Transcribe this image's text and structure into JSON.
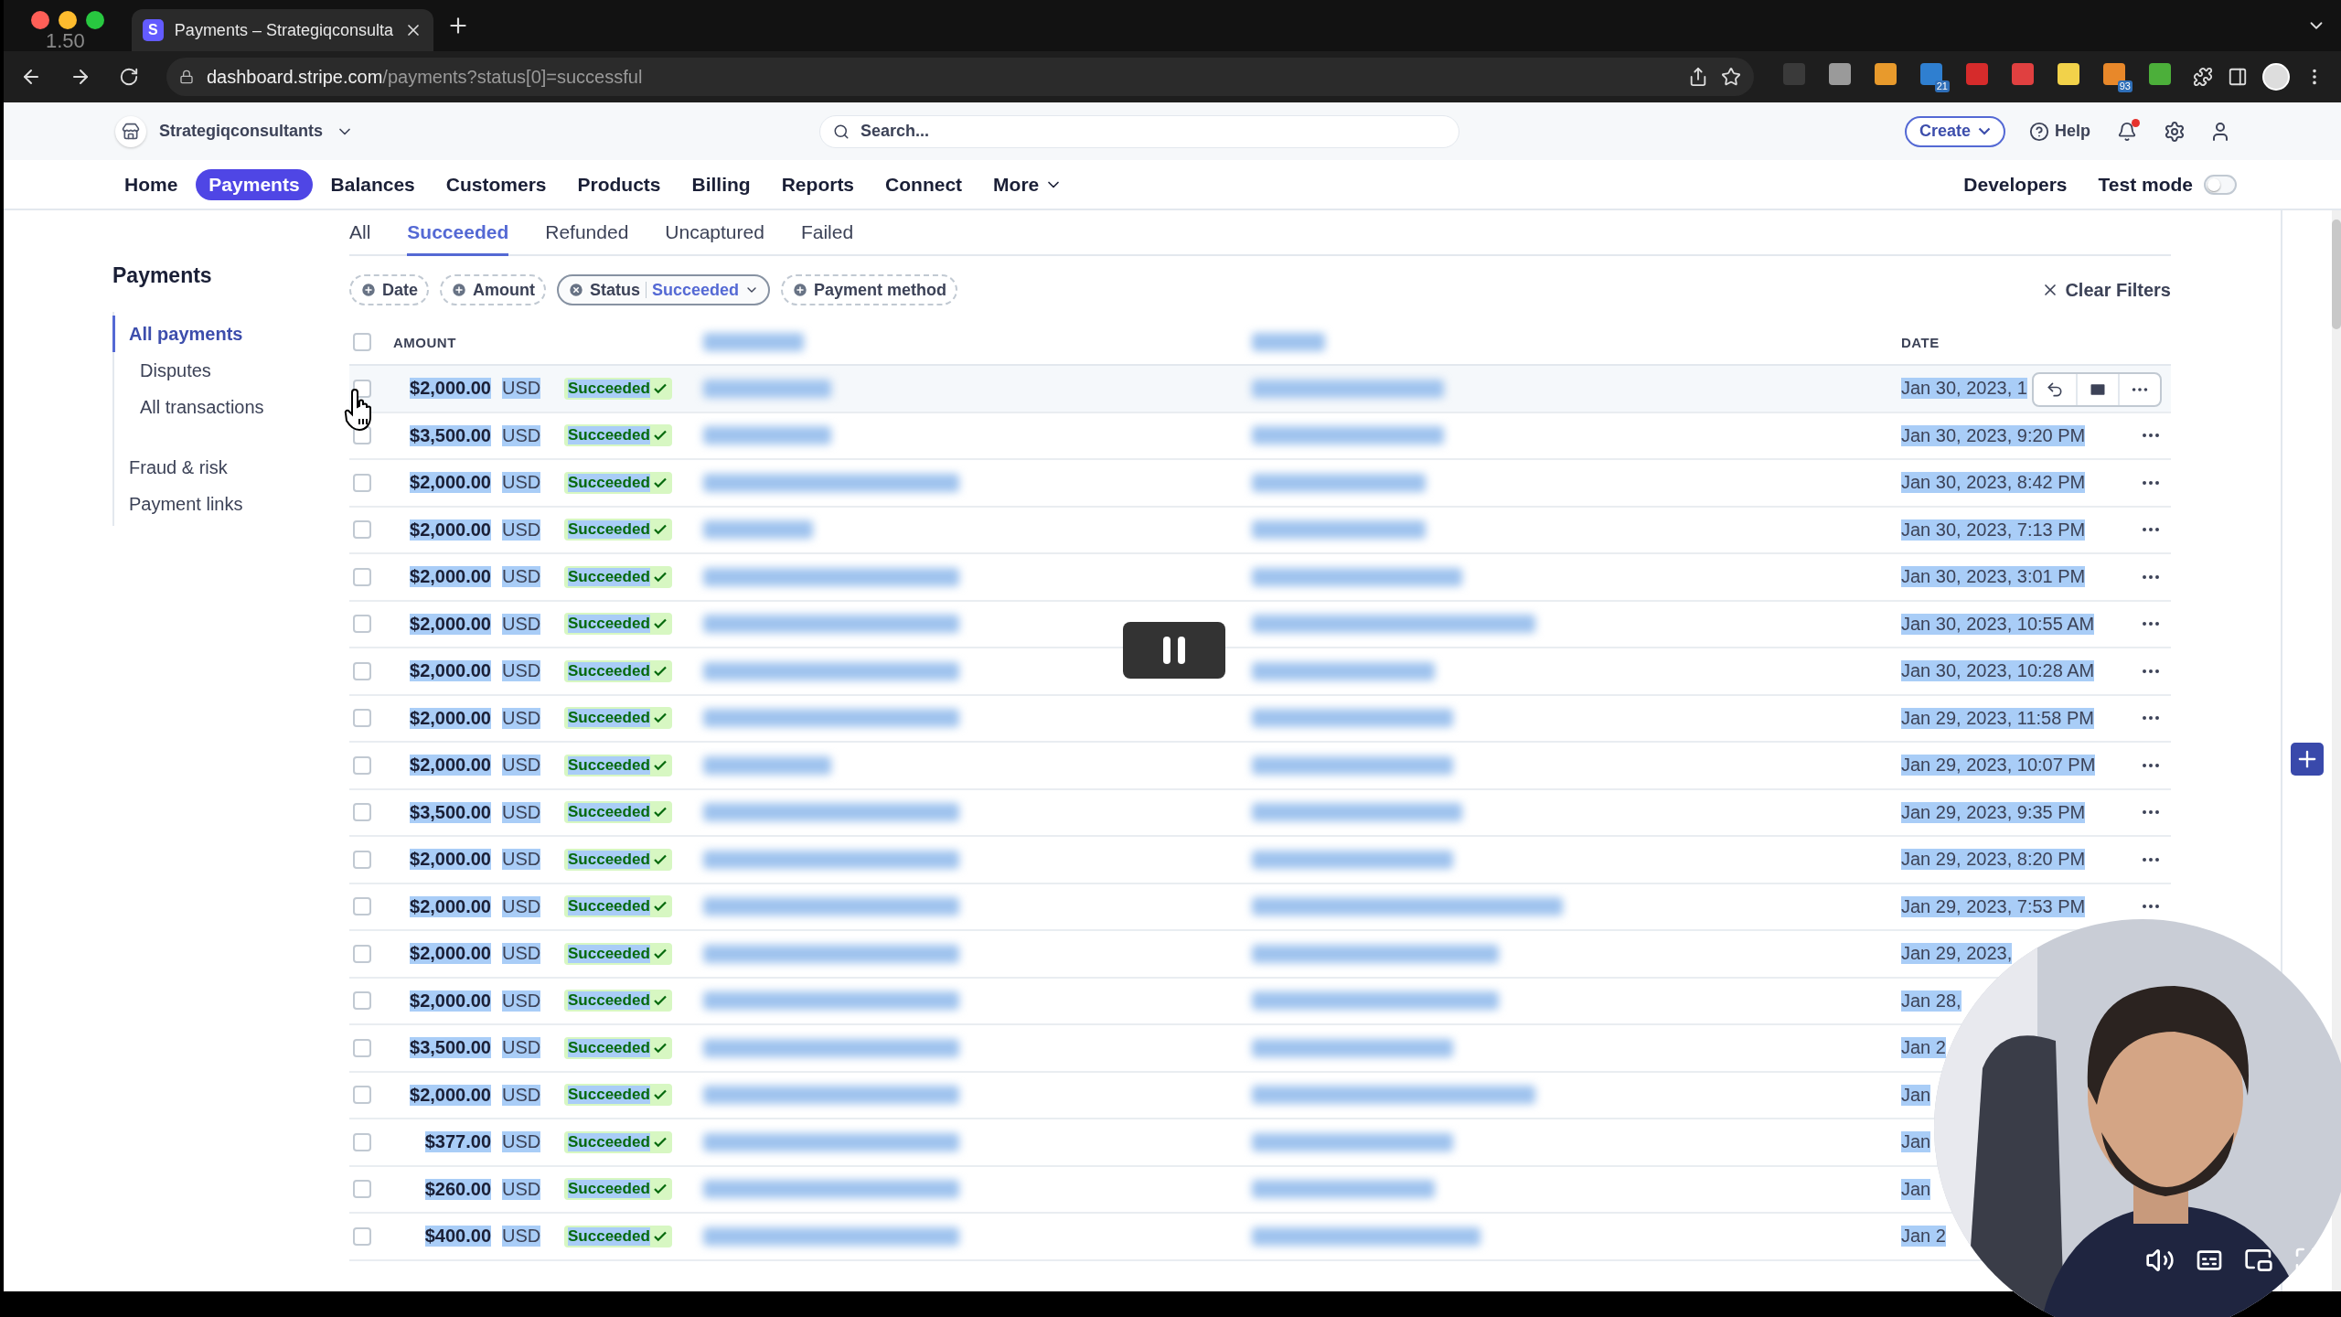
{
  "video": {
    "playback_speed": "1.50",
    "paused": true
  },
  "browser": {
    "tab": {
      "favicon": "S",
      "title": "Payments – Strategiqconsulta"
    },
    "url": {
      "host": "dashboard.stripe.com",
      "path": "/payments?status[0]=successful"
    },
    "extensions": [
      {
        "color": "#3a3a3a"
      },
      {
        "color": "#9a9a9a"
      },
      {
        "color": "#e89a2c"
      },
      {
        "color": "#2f7fd0",
        "badge": "21"
      },
      {
        "color": "#d62b2b"
      },
      {
        "color": "#e04040"
      },
      {
        "color": "#f2d24a"
      },
      {
        "color": "#e8882a",
        "badge": "93"
      },
      {
        "color": "#4caf3a"
      }
    ]
  },
  "header": {
    "account": "Strategiqconsultants",
    "search": {
      "placeholder": "Search..."
    },
    "create": "Create",
    "help": "Help",
    "notifications_unread": true
  },
  "nav": {
    "items": [
      {
        "label": "Home",
        "selected": false
      },
      {
        "label": "Payments",
        "selected": true
      },
      {
        "label": "Balances",
        "selected": false
      },
      {
        "label": "Customers",
        "selected": false
      },
      {
        "label": "Products",
        "selected": false
      },
      {
        "label": "Billing",
        "selected": false
      },
      {
        "label": "Reports",
        "selected": false
      },
      {
        "label": "Connect",
        "selected": false
      },
      {
        "label": "More",
        "selected": false
      }
    ],
    "developers": "Developers",
    "test_mode": {
      "label": "Test mode",
      "on": false
    }
  },
  "sidebar": {
    "title": "Payments",
    "items": [
      {
        "label": "All payments",
        "selected": true,
        "children": [
          {
            "label": "Disputes",
            "selected": false
          },
          {
            "label": "All transactions",
            "selected": false
          }
        ]
      },
      {
        "label": "Fraud & risk",
        "selected": false
      },
      {
        "label": "Payment links",
        "selected": false
      }
    ]
  },
  "tabs": [
    {
      "label": "All",
      "selected": false
    },
    {
      "label": "Succeeded",
      "selected": true
    },
    {
      "label": "Refunded",
      "selected": false
    },
    {
      "label": "Uncaptured",
      "selected": false
    },
    {
      "label": "Failed",
      "selected": false
    }
  ],
  "filters": [
    {
      "label": "Date",
      "active": false
    },
    {
      "label": "Amount",
      "active": false
    },
    {
      "label": "Status",
      "value": "Succeeded",
      "active": true
    },
    {
      "label": "Payment method",
      "active": false
    }
  ],
  "clear_filters": "Clear Filters",
  "table": {
    "text_selected": true,
    "select_all_checked": false,
    "columns": [
      "AMOUNT",
      "DATE"
    ],
    "rows": [
      {
        "amount": "$2,000.00",
        "currency": "USD",
        "status": "Succeeded",
        "date": "Jan 30, 2023, 1",
        "checked": false,
        "hovered": true
      },
      {
        "amount": "$3,500.00",
        "currency": "USD",
        "status": "Succeeded",
        "date": "Jan 30, 2023, 9:20 PM",
        "checked": false,
        "hovered": false
      },
      {
        "amount": "$2,000.00",
        "currency": "USD",
        "status": "Succeeded",
        "date": "Jan 30, 2023, 8:42 PM",
        "checked": false,
        "hovered": false
      },
      {
        "amount": "$2,000.00",
        "currency": "USD",
        "status": "Succeeded",
        "date": "Jan 30, 2023, 7:13 PM",
        "checked": false,
        "hovered": false
      },
      {
        "amount": "$2,000.00",
        "currency": "USD",
        "status": "Succeeded",
        "date": "Jan 30, 2023, 3:01 PM",
        "checked": false,
        "hovered": false
      },
      {
        "amount": "$2,000.00",
        "currency": "USD",
        "status": "Succeeded",
        "date": "Jan 30, 2023, 10:55 AM",
        "checked": false,
        "hovered": false
      },
      {
        "amount": "$2,000.00",
        "currency": "USD",
        "status": "Succeeded",
        "date": "Jan 30, 2023, 10:28 AM",
        "checked": false,
        "hovered": false
      },
      {
        "amount": "$2,000.00",
        "currency": "USD",
        "status": "Succeeded",
        "date": "Jan 29, 2023, 11:58 PM",
        "checked": false,
        "hovered": false
      },
      {
        "amount": "$2,000.00",
        "currency": "USD",
        "status": "Succeeded",
        "date": "Jan 29, 2023, 10:07 PM",
        "checked": false,
        "hovered": false
      },
      {
        "amount": "$3,500.00",
        "currency": "USD",
        "status": "Succeeded",
        "date": "Jan 29, 2023, 9:35 PM",
        "checked": false,
        "hovered": false
      },
      {
        "amount": "$2,000.00",
        "currency": "USD",
        "status": "Succeeded",
        "date": "Jan 29, 2023, 8:20 PM",
        "checked": false,
        "hovered": false
      },
      {
        "amount": "$2,000.00",
        "currency": "USD",
        "status": "Succeeded",
        "date": "Jan 29, 2023, 7:53 PM",
        "checked": false,
        "hovered": false
      },
      {
        "amount": "$2,000.00",
        "currency": "USD",
        "status": "Succeeded",
        "date": "Jan 29, 2023,",
        "checked": false,
        "hovered": false
      },
      {
        "amount": "$2,000.00",
        "currency": "USD",
        "status": "Succeeded",
        "date": "Jan 28,",
        "checked": false,
        "hovered": false
      },
      {
        "amount": "$3,500.00",
        "currency": "USD",
        "status": "Succeeded",
        "date": "Jan 2",
        "checked": false,
        "hovered": false
      },
      {
        "amount": "$2,000.00",
        "currency": "USD",
        "status": "Succeeded",
        "date": "Jan",
        "checked": false,
        "hovered": false
      },
      {
        "amount": "$377.00",
        "currency": "USD",
        "status": "Succeeded",
        "date": "Jan",
        "checked": false,
        "hovered": false
      },
      {
        "amount": "$260.00",
        "currency": "USD",
        "status": "Succeeded",
        "date": "Jan",
        "checked": false,
        "hovered": false
      },
      {
        "amount": "$400.00",
        "currency": "USD",
        "status": "Succeeded",
        "date": "Jan 2",
        "checked": false,
        "hovered": false
      }
    ]
  }
}
